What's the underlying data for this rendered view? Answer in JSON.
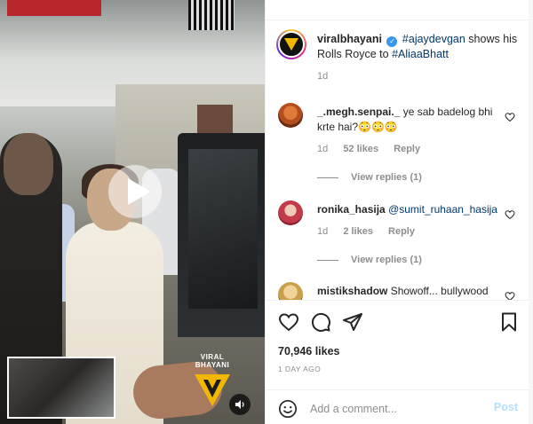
{
  "video": {
    "watermark_text": "VIRAL BHAYANI"
  },
  "post": {
    "author": "viralbhayani",
    "caption_tag1": "#ajaydevgan",
    "caption_mid": " shows his Rolls Royce to ",
    "caption_tag2": "#AliaaBhatt",
    "caption_time": "1d"
  },
  "comments": [
    {
      "username": "_.megh.senpai._",
      "text": "ye sab badelog bhi krte hai?😳😳😳",
      "time": "1d",
      "likes": "52 likes",
      "reply": "Reply",
      "view_replies": "View replies (1)"
    },
    {
      "username": "ronika_hasija",
      "mention": "@sumit_ruhaan_hasija",
      "time": "1d",
      "likes": "2 likes",
      "reply": "Reply",
      "view_replies": "View replies (1)"
    },
    {
      "username": "mistikshadow",
      "text": "Showoff... bullywood"
    }
  ],
  "likes_count": "70,946 likes",
  "time_ago": "1 DAY AGO",
  "add_comment": {
    "placeholder": "Add a comment...",
    "post_label": "Post"
  },
  "colors": {
    "link": "#00376b",
    "verified": "#3897f0",
    "post_disabled": "#b2dffc"
  }
}
